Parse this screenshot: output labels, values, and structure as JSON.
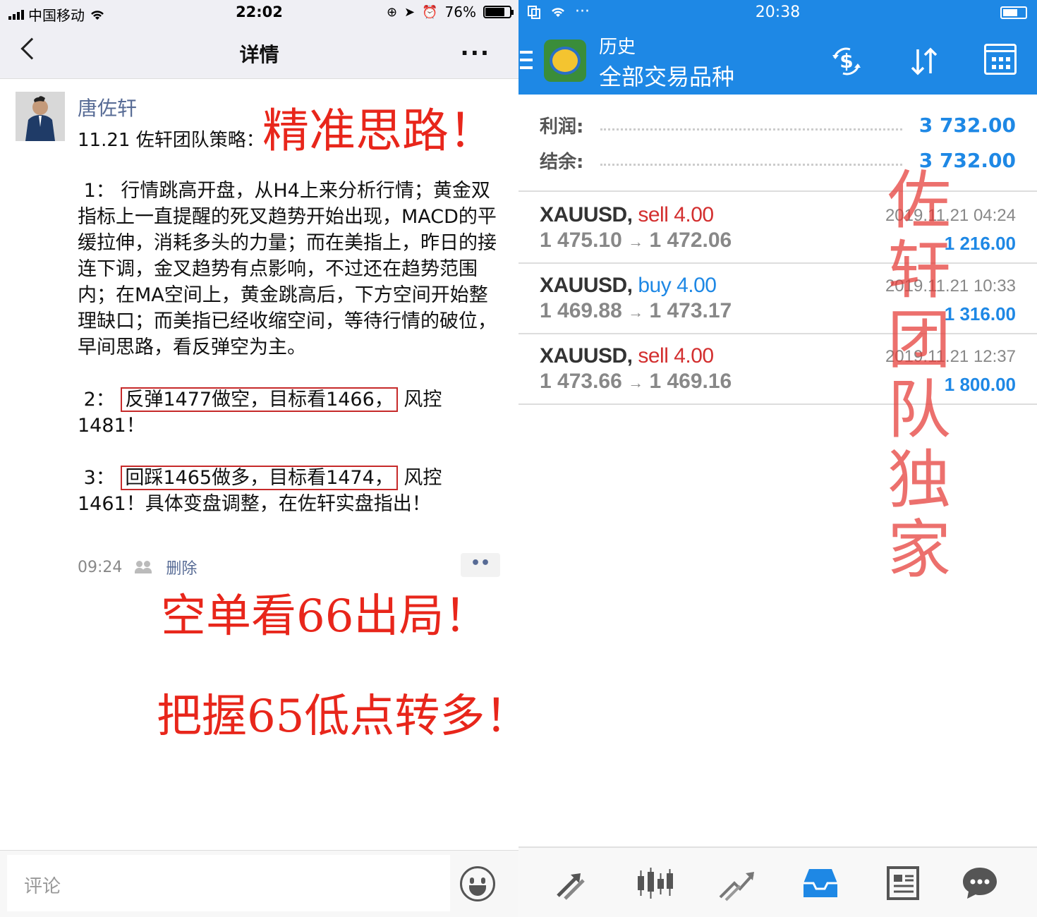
{
  "left": {
    "status_bar": {
      "carrier": "中国移动",
      "time": "22:02",
      "battery": "76%"
    },
    "nav": {
      "title": "详情",
      "more": "···"
    },
    "post": {
      "author": "唐佐轩",
      "subtitle": "11.21 佐轩团队策略：",
      "p1": " 1： 行情跳高开盘，从H4上来分析行情；黄金双指标上一直提醒的死叉趋势开始出现，MACD的平缓拉伸，消耗多头的力量；而在美指上，昨日的接连下调，金叉趋势有点影响，不过还在趋势范围内；在MA空间上，黄金跳高后，下方空间开始整理缺口；而美指已经收缩空间，等待行情的破位，早间思路，看反弹空为主。",
      "p2_prefix": " 2： ",
      "p2_boxed": "反弹1477做空，目标看1466，",
      "p2_suffix": " 风控1481！",
      "p3_prefix": " 3： ",
      "p3_boxed": "回踩1465做多，目标看1474，",
      "p3_suffix": " 风控1461！具体变盘调整，在佐轩实盘指出！",
      "time": "09:24",
      "delete_label": "删除",
      "dots_label": "••"
    },
    "annotations": {
      "a1": "精准思路！",
      "a2": "空单看66出局！",
      "a3": "把握65低点转多！"
    },
    "comment_placeholder": "评论"
  },
  "right": {
    "status_bar": {
      "time": "20:38",
      "dots": "···"
    },
    "toolbar": {
      "title": "历史",
      "subtitle": "全部交易品种"
    },
    "summary": {
      "profit_label": "利润:",
      "profit_value": "3 732.00",
      "balance_label": "结余:",
      "balance_value": "3 732.00"
    },
    "trades": [
      {
        "symbol": "XAUUSD,",
        "side": "sell",
        "volume": "4.00",
        "open": "1 475.10",
        "arrow": "→",
        "close": "1 472.06",
        "datetime": "2019.11.21 04:24",
        "profit": "1 216.00"
      },
      {
        "symbol": "XAUUSD,",
        "side": "buy",
        "volume": "4.00",
        "open": "1 469.88",
        "arrow": "→",
        "close": "1 473.17",
        "datetime": "2019.11.21 10:33",
        "profit": "1 316.00"
      },
      {
        "symbol": "XAUUSD,",
        "side": "sell",
        "volume": "4.00",
        "open": "1 473.66",
        "arrow": "→",
        "close": "1 469.16",
        "datetime": "2019.11.21 12:37",
        "profit": "1 800.00"
      }
    ],
    "watermark": {
      "c1": "佐",
      "c2": "轩",
      "c3": "团",
      "c4": "队",
      "c5": "独",
      "c6": "家"
    }
  },
  "colors": {
    "mt_blue": "#1e88e5",
    "sell_red": "#d32f2f",
    "annotation_red": "#e8261b",
    "link_blue": "#576b95"
  }
}
